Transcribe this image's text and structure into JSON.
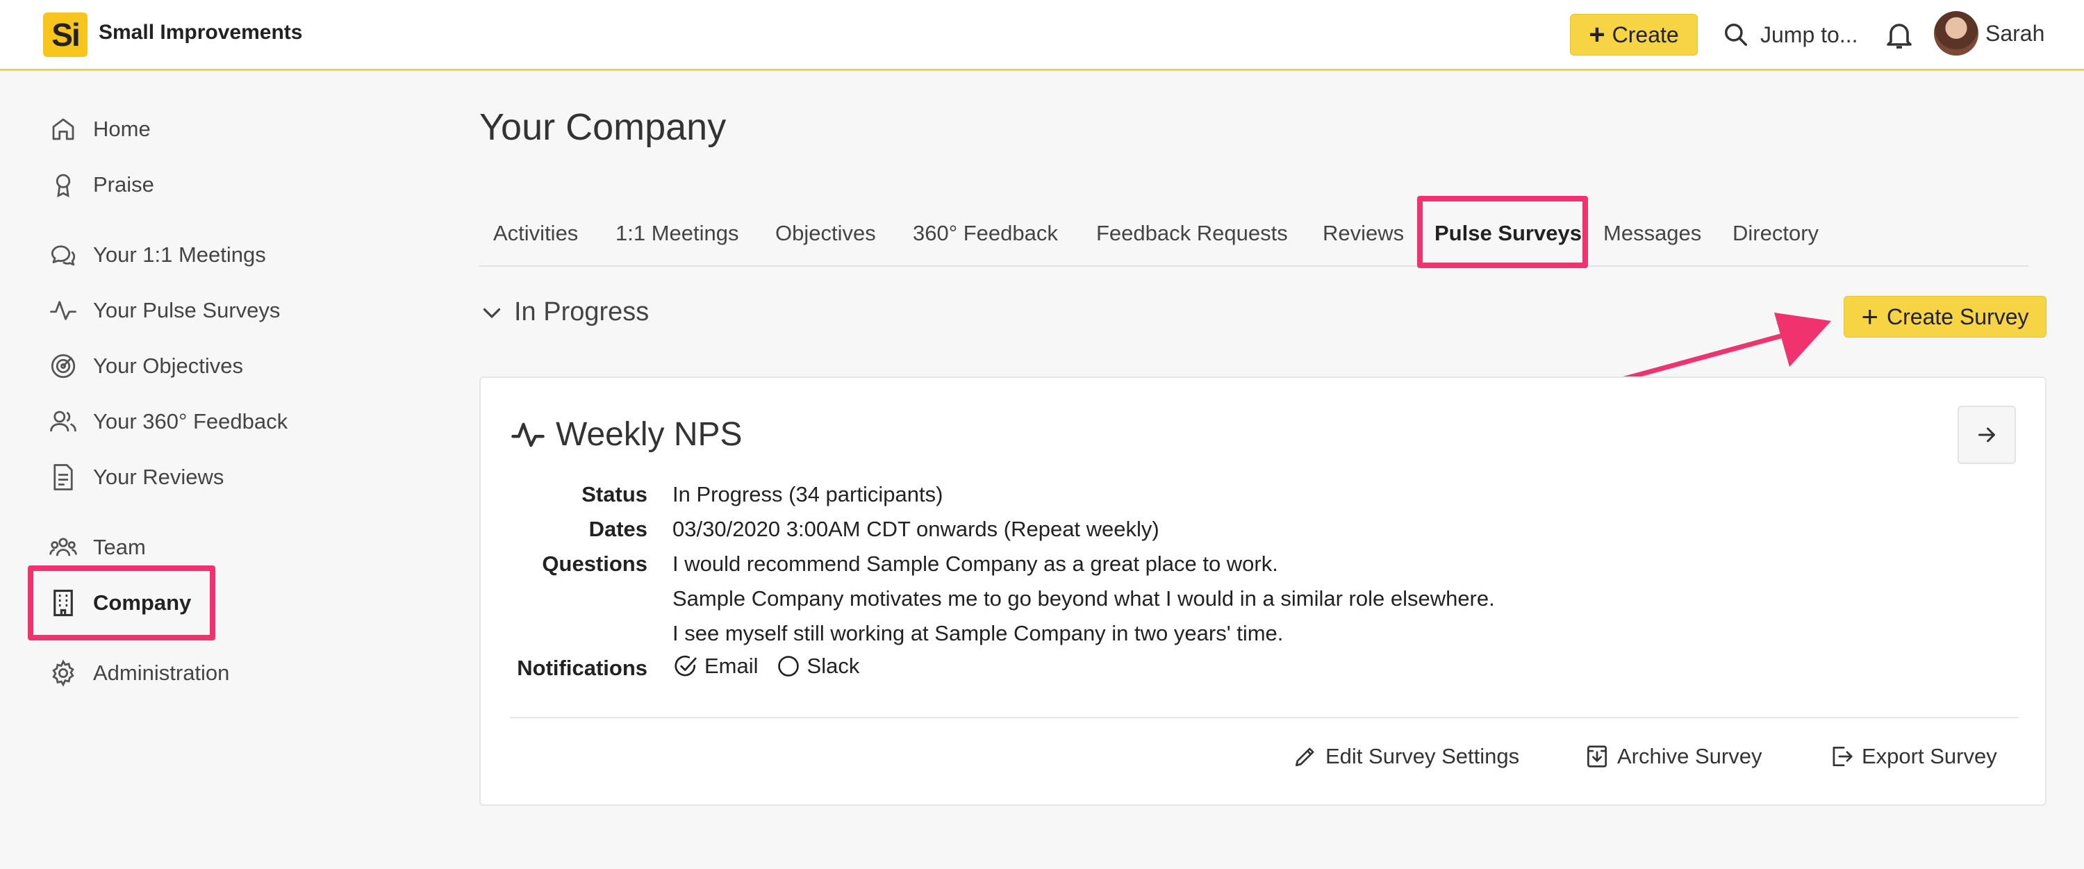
{
  "header": {
    "logo_text": "Si",
    "brand": "Small Improvements",
    "create_label": "Create",
    "jump_label": "Jump to...",
    "user_name": "Sarah"
  },
  "sidebar": {
    "items": [
      {
        "label": "Home",
        "icon": "home-icon"
      },
      {
        "label": "Praise",
        "icon": "award-icon"
      },
      {
        "label": "Your 1:1 Meetings",
        "icon": "chat-icon"
      },
      {
        "label": "Your Pulse Surveys",
        "icon": "pulse-icon"
      },
      {
        "label": "Your Objectives",
        "icon": "target-icon"
      },
      {
        "label": "Your 360° Feedback",
        "icon": "people-icon"
      },
      {
        "label": "Your Reviews",
        "icon": "document-icon"
      },
      {
        "label": "Team",
        "icon": "team-icon"
      },
      {
        "label": "Company",
        "icon": "building-icon",
        "active": true
      },
      {
        "label": "Administration",
        "icon": "gear-icon"
      }
    ]
  },
  "main": {
    "title": "Your Company",
    "tabs": [
      {
        "label": "Activities"
      },
      {
        "label": "1:1 Meetings"
      },
      {
        "label": "Objectives"
      },
      {
        "label": "360° Feedback"
      },
      {
        "label": "Feedback Requests"
      },
      {
        "label": "Reviews"
      },
      {
        "label": "Pulse Surveys",
        "active": true
      },
      {
        "label": "Messages"
      },
      {
        "label": "Directory"
      }
    ],
    "section_label": "In Progress",
    "create_survey_label": "Create Survey",
    "survey": {
      "title": "Weekly NPS",
      "status_label": "Status",
      "status_value": "In Progress (34 participants)",
      "dates_label": "Dates",
      "dates_value": "03/30/2020 3:00AM CDT onwards (Repeat weekly)",
      "questions_label": "Questions",
      "questions": [
        "I would recommend Sample Company as a great place to work.",
        "Sample Company motivates me to go beyond what I would in a similar role elsewhere.",
        "I see myself still working at Sample Company in two years' time."
      ],
      "notifications_label": "Notifications",
      "notifications": [
        {
          "label": "Email",
          "checked": true
        },
        {
          "label": "Slack",
          "checked": false
        }
      ],
      "actions": {
        "edit": "Edit Survey Settings",
        "archive": "Archive Survey",
        "export": "Export Survey"
      }
    }
  },
  "colors": {
    "accent_yellow": "#f7d443",
    "highlight_pink": "#f0336e",
    "topbar_border": "#f2d33f"
  }
}
